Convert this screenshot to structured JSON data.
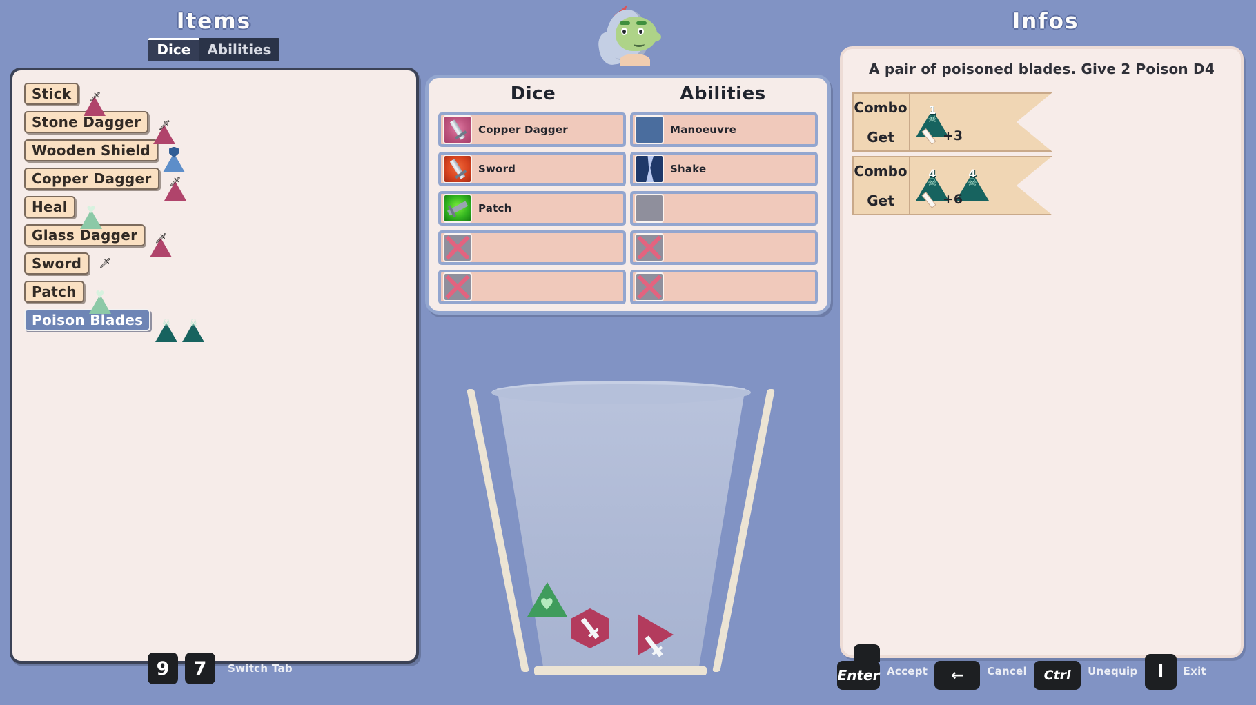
{
  "items": {
    "title": "Items",
    "tabs": [
      {
        "label": "Dice",
        "active": true
      },
      {
        "label": "Abilities",
        "active": false
      }
    ],
    "list": [
      {
        "label": "Stick",
        "selected": false,
        "faces": [
          "dagger-red-triangle"
        ]
      },
      {
        "label": "Stone Dagger",
        "selected": false,
        "faces": [
          "dagger-red-triangle"
        ]
      },
      {
        "label": "Wooden Shield",
        "selected": false,
        "faces": [
          "shield-blue-triangle"
        ]
      },
      {
        "label": "Copper Dagger",
        "selected": false,
        "faces": [
          "dagger-red-triangle"
        ]
      },
      {
        "label": "Heal",
        "selected": false,
        "faces": [
          "heart-green-triangle"
        ]
      },
      {
        "label": "Glass Dagger",
        "selected": false,
        "faces": [
          "dagger-red-triangle"
        ]
      },
      {
        "label": "Sword",
        "selected": false,
        "faces": [
          "dagger-red-hexagon"
        ]
      },
      {
        "label": "Patch",
        "selected": false,
        "faces": [
          "heart-green-triangle"
        ]
      },
      {
        "label": "Poison Blades",
        "selected": true,
        "faces": [
          "skull-teal-triangle",
          "skull-teal-triangle"
        ]
      }
    ]
  },
  "loadout": {
    "dice_header": "Dice",
    "abilities_header": "Abilities",
    "dice_slots": [
      {
        "label": "Copper Dagger",
        "icon": "copper-dagger-icon",
        "locked": false
      },
      {
        "label": "Sword",
        "icon": "sword-icon",
        "locked": false
      },
      {
        "label": "Patch",
        "icon": "patch-icon",
        "locked": false
      },
      {
        "label": "",
        "icon": "locked-slot-icon",
        "locked": true
      },
      {
        "label": "",
        "icon": "locked-slot-icon",
        "locked": true
      }
    ],
    "ability_slots": [
      {
        "label": "Manoeuvre",
        "icon": "manoeuvre-icon",
        "locked": false
      },
      {
        "label": "Shake",
        "icon": "shake-icon",
        "locked": false
      },
      {
        "label": "",
        "icon": "empty-slot-icon",
        "locked": false
      },
      {
        "label": "",
        "icon": "locked-slot-icon",
        "locked": true
      },
      {
        "label": "",
        "icon": "locked-slot-icon",
        "locked": true
      }
    ]
  },
  "dice_cup": {
    "dice": [
      {
        "shape": "triangle",
        "color": "#3f9c5c",
        "glyph": "heart"
      },
      {
        "shape": "hexagon",
        "color": "#b33b5d",
        "glyph": "dagger"
      },
      {
        "shape": "triangle",
        "color": "#b33b5d",
        "glyph": "dagger"
      }
    ]
  },
  "infos": {
    "title": "Infos",
    "description": "A pair of poisoned blades.  Give 2 Poison D4",
    "combos": [
      {
        "combo_label": "Combo",
        "get_label": "Get",
        "faces": [
          {
            "value": "1",
            "type": "skull-teal-triangle"
          }
        ],
        "reward_icon": "dagger-icon",
        "reward_value": "+3"
      },
      {
        "combo_label": "Combo",
        "get_label": "Get",
        "faces": [
          {
            "value": "4",
            "type": "skull-teal-triangle"
          },
          {
            "value": "4",
            "type": "skull-teal-triangle"
          }
        ],
        "reward_icon": "dagger-icon",
        "reward_value": "+6"
      }
    ]
  },
  "hints": {
    "left": [
      {
        "keys": [
          "9",
          "7"
        ],
        "label": "Switch Tab"
      }
    ],
    "right": [
      {
        "key": "Enter",
        "label": "Accept"
      },
      {
        "key": "←",
        "label": "Cancel"
      },
      {
        "key": "Ctrl",
        "label": "Unequip"
      },
      {
        "key": "I",
        "label": "Exit"
      }
    ]
  },
  "colors": {
    "background": "#8193c4",
    "panel": "#f6ece9",
    "slot": "#f0c9bb",
    "slot_border": "#93a6cf",
    "chip": "#fae0c2",
    "chip_selected": "#6e85b5",
    "banner": "#f0d6b4",
    "teal": "#17635f",
    "red": "#b0446b"
  }
}
